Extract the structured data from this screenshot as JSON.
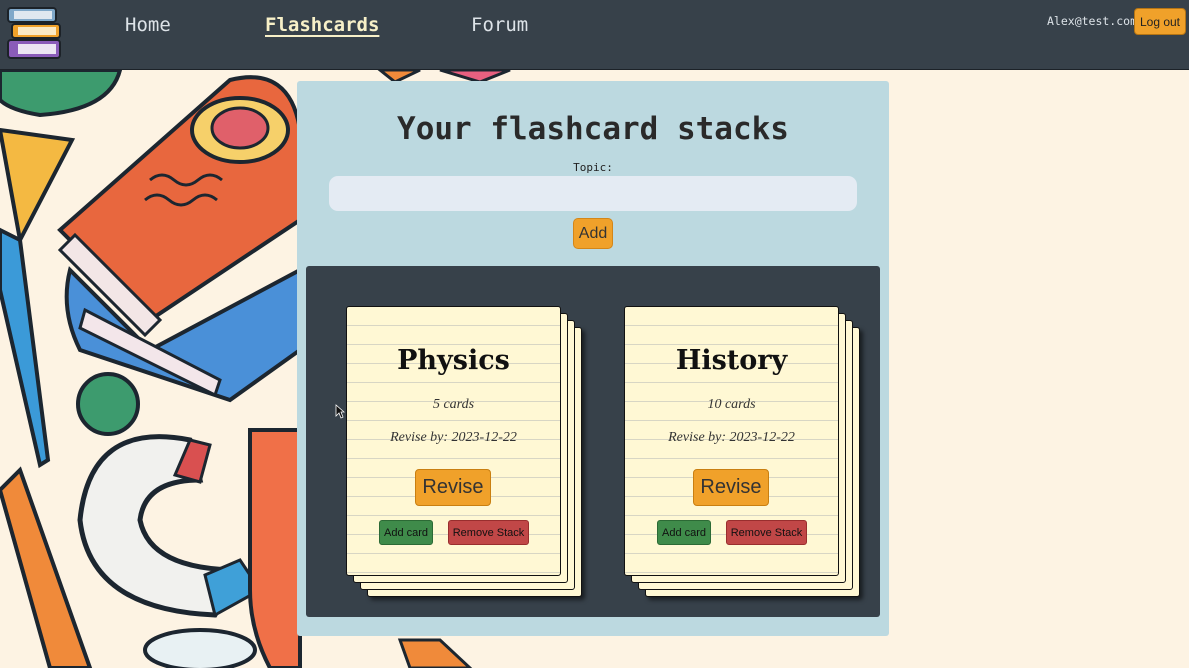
{
  "nav": {
    "links": [
      {
        "label": "Home"
      },
      {
        "label": "Flashcards"
      },
      {
        "label": "Forum"
      }
    ],
    "user_email": "Alex@test.com",
    "logout_label": "Log out"
  },
  "main": {
    "title": "Your flashcard stacks",
    "topic_label": "Topic:",
    "topic_input_value": "",
    "add_label": "Add",
    "stacks": [
      {
        "name": "Physics",
        "card_count": "5 cards",
        "revise_by": "Revise by: 2023-12-22",
        "revise_label": "Revise",
        "add_card_label": "Add card",
        "remove_label": "Remove Stack"
      },
      {
        "name": "History",
        "card_count": "10 cards",
        "revise_by": "Revise by: 2023-12-22",
        "revise_label": "Revise",
        "add_card_label": "Add card",
        "remove_label": "Remove Stack"
      }
    ]
  },
  "colors": {
    "navbar": "#37414a",
    "accent_orange": "#f0a12a",
    "panel": "#bcd9e0",
    "card": "#fff8d4",
    "add_card_green": "#3f8b4a",
    "remove_red": "#c14747"
  },
  "icons": {
    "logo": "stacked-books-logo",
    "cursor": "mouse-pointer"
  }
}
